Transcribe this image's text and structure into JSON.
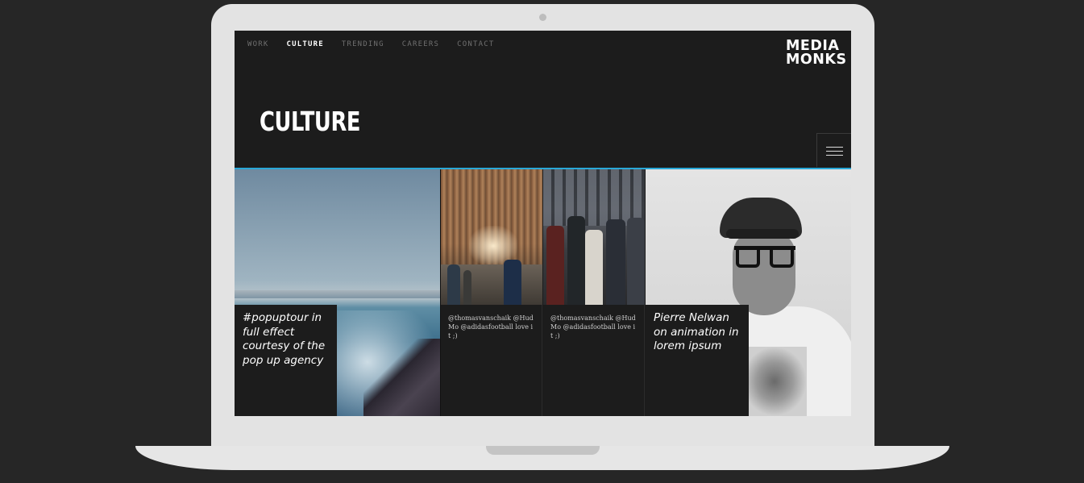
{
  "nav": {
    "items": [
      {
        "label": "WORK",
        "active": false
      },
      {
        "label": "CULTURE",
        "active": true
      },
      {
        "label": "TRENDING",
        "active": false
      },
      {
        "label": "CAREERS",
        "active": false
      },
      {
        "label": "CONTACT",
        "active": false
      }
    ]
  },
  "logo": {
    "line1": "MEDIA",
    "line2": "MONKS"
  },
  "page": {
    "title": "CULTURE"
  },
  "menu": {
    "icon": "hamburger-menu-icon"
  },
  "colors": {
    "accent": "#29a8d8",
    "background": "#1c1c1c",
    "frame": "#e3e3e3"
  },
  "tiles": [
    {
      "caption": "#popuptour in full effect courtesy of the pop up agency",
      "image": "sea-rocks-photo"
    },
    {
      "caption": "@thomasvanschaik @HudMo @adidasfootball love it ;)",
      "image": "hangar-photo"
    },
    {
      "caption": "@thomasvanschaik @HudMo @adidasfootball love it ;)",
      "image": "street-group-photo"
    },
    {
      "caption": "Pierre Nelwan on animation in lorem ipsum",
      "image": "portrait-photo"
    }
  ]
}
